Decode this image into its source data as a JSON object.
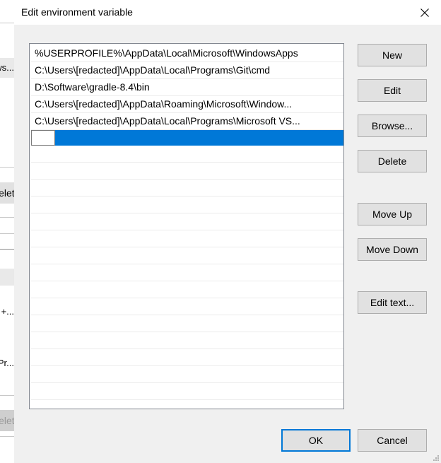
{
  "background_window": {
    "partial_texts": [
      "ws...",
      "+...",
      "Pr..."
    ],
    "partial_buttons": [
      "Delete",
      "Delete"
    ]
  },
  "dialog": {
    "title": "Edit environment variable",
    "close_icon": "close-icon",
    "list": {
      "items": [
        "%USERPROFILE%\\AppData\\Local\\Microsoft\\WindowsApps",
        "C:\\Users\\[redacted]\\AppData\\Local\\Programs\\Git\\cmd",
        "D:\\Software\\gradle-8.4\\bin",
        "C:\\Users\\[redacted]\\AppData\\Roaming\\Microsoft\\Window...",
        "C:\\Users\\[redacted]\\AppData\\Local\\Programs\\Microsoft VS..."
      ],
      "editing_item_value": "",
      "selected_index": 5
    },
    "buttons": {
      "new": "New",
      "edit": "Edit",
      "browse": "Browse...",
      "delete": "Delete",
      "move_up": "Move Up",
      "move_down": "Move Down",
      "edit_text": "Edit text..."
    },
    "footer": {
      "ok": "OK",
      "cancel": "Cancel"
    },
    "colors": {
      "selection": "#0078d7",
      "default_button_border": "#0078d7",
      "button_face": "#e1e1e1",
      "dialog_background": "#f0f0f0"
    }
  }
}
